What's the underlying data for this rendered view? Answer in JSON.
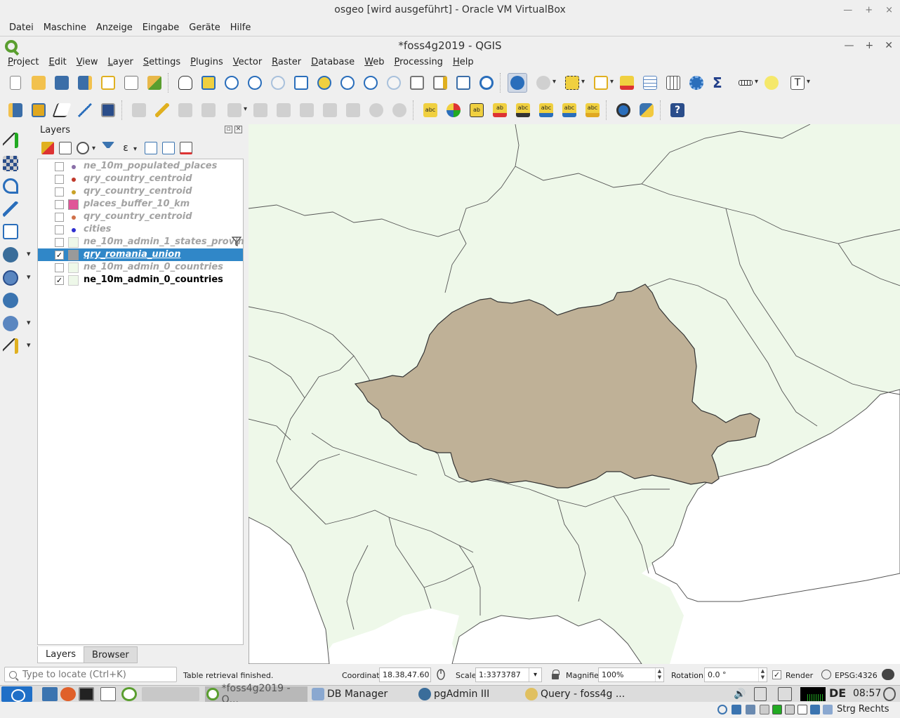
{
  "virtualbox": {
    "title": "osgeo [wird ausgeführt] - Oracle VM VirtualBox",
    "menu": [
      "Datei",
      "Maschine",
      "Anzeige",
      "Eingabe",
      "Geräte",
      "Hilfe"
    ],
    "host_key": "Strg Rechts"
  },
  "qgis": {
    "title": "*foss4g2019 - QGIS",
    "menu": [
      "Project",
      "Edit",
      "View",
      "Layer",
      "Settings",
      "Plugins",
      "Vector",
      "Raster",
      "Database",
      "Web",
      "Processing",
      "Help"
    ]
  },
  "toolbar1": [
    "new-project-icon",
    "open-project-icon",
    "save-project-icon",
    "save-as-icon",
    "new-print-layout-icon",
    "layout-manager-icon",
    "style-manager-icon",
    "pan-icon",
    "pan-to-selection-icon",
    "zoom-in-icon",
    "zoom-out-icon",
    "zoom-native-icon",
    "zoom-full-icon",
    "zoom-to-selection-icon",
    "zoom-to-layer-icon",
    "zoom-last-icon",
    "zoom-next-icon",
    "new-map-view-icon",
    "new-3d-view-icon",
    "spatial-bookmarks-icon",
    "refresh-icon",
    "identify-icon",
    "run-action-icon",
    "select-features-icon",
    "select-by-value-icon",
    "deselect-icon",
    "attribute-table-icon",
    "field-calculator-icon",
    "processing-toolbox-icon",
    "statistics-icon",
    "measure-icon",
    "map-tips-icon",
    "text-annotation-icon"
  ],
  "toolbar2": [
    "data-source-manager-icon",
    "new-geopackage-layer-icon",
    "digitize-icon",
    "digitize-line-icon",
    "gps-icon",
    "current-edits-icon",
    "toggle-editing-icon",
    "save-edits-icon",
    "add-feature-icon",
    "vertex-tool-icon",
    "modify-attributes-icon",
    "delete-selected-icon",
    "cut-features-icon",
    "copy-features-icon",
    "paste-features-icon",
    "undo-icon",
    "redo-icon",
    "label-toolbar-icon",
    "diagram-icon",
    "highlight-pinned-icon",
    "pin-labels-icon",
    "show-hide-labels-icon",
    "move-label-icon",
    "rotate-label-icon",
    "change-label-icon",
    "label-properties-icon",
    "metasearch-icon",
    "python-console-icon",
    "help-icon"
  ],
  "left_toolbar": [
    "add-vector-layer-icon",
    "add-raster-layer-icon",
    "add-mesh-layer-icon",
    "add-delimited-text-icon",
    "add-spatialite-icon",
    "add-postgis-icon",
    "add-wms-icon",
    "add-wcs-icon",
    "add-wfs-icon",
    "add-virtual-layer-icon"
  ],
  "layers_panel": {
    "title": "Layers",
    "layers": [
      {
        "name": "ne_10m_populated_places",
        "checked": false,
        "symbol": "dot",
        "color": "#8a6fa8"
      },
      {
        "name": "qry_country_centroid",
        "checked": false,
        "symbol": "dot",
        "color": "#c0392b"
      },
      {
        "name": "qry_country_centroid",
        "checked": false,
        "symbol": "dot",
        "color": "#c9a227"
      },
      {
        "name": "places_buffer_10_km",
        "checked": false,
        "symbol": "poly",
        "color": "#e05598"
      },
      {
        "name": "qry_country_centroid",
        "checked": false,
        "symbol": "dot",
        "color": "#d0714a"
      },
      {
        "name": "cities",
        "checked": false,
        "symbol": "dot",
        "color": "#2f2fd0"
      },
      {
        "name": "ne_10m_admin_1_states_provin",
        "checked": false,
        "symbol": "poly",
        "color": "#eef8e9",
        "filter": true
      },
      {
        "name": "qry_romania_union",
        "checked": true,
        "symbol": "poly",
        "color": "#9a9a9a",
        "selected": true
      },
      {
        "name": "ne_10m_admin_0_countries",
        "checked": false,
        "symbol": "poly",
        "color": "#eef8e9"
      },
      {
        "name": "ne_10m_admin_0_countries",
        "checked": true,
        "symbol": "poly",
        "color": "#eef8e9"
      }
    ],
    "tabs": [
      "Layers",
      "Browser"
    ]
  },
  "map": {
    "land_color": "#eef8e9",
    "sea_color": "#ffffff",
    "highlight_color": "#bfb197",
    "border_color": "#555555"
  },
  "statusbar": {
    "locator_placeholder": "Type to locate (Ctrl+K)",
    "message": "Table retrieval finished.",
    "coordinate_label": "Coordinate",
    "coordinate": "18.38,47.60",
    "scale_label": "Scale",
    "scale": "1:3373787",
    "magnifier_label": "Magnifier",
    "magnifier": "100%",
    "rotation_label": "Rotation",
    "rotation": "0.0 °",
    "render_label": "Render",
    "crs": "EPSG:4326"
  },
  "taskbar": {
    "tasks": [
      "*foss4g2019 - Q...",
      "DB Manager",
      "pgAdmin III",
      "Query - foss4g ..."
    ],
    "keyboard_layout": "DE",
    "time": "08:57"
  }
}
